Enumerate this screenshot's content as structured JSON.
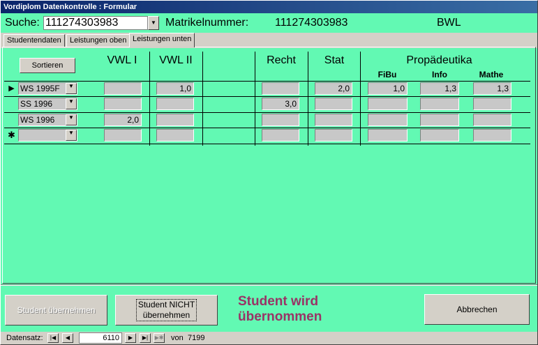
{
  "window": {
    "title": "Vordiplom Datenkontrolle : Formular"
  },
  "header": {
    "search_label": "Suche:",
    "search_value": "111274303983",
    "matrikel_label": "Matrikelnummer:",
    "matrikel_value": "111274303983",
    "program": "BWL"
  },
  "tabs": [
    {
      "label": "Studentendaten",
      "active": false
    },
    {
      "label": "Leistungen oben",
      "active": false
    },
    {
      "label": "Leistungen unten",
      "active": true
    }
  ],
  "grid": {
    "sort_button": "Sortieren",
    "columns": {
      "vwl1": "VWL I",
      "vwl2": "VWL II",
      "recht": "Recht",
      "stat": "Stat",
      "propaedeutika": "Propädeutika",
      "fibu": "FiBu",
      "info": "Info",
      "mathe": "Mathe"
    },
    "rows": [
      {
        "semester": "WS 1995F",
        "vwl1": "",
        "vwl2": "1,0",
        "recht": "",
        "stat": "2,0",
        "fibu": "1,0",
        "info": "1,3",
        "mathe": "1,3",
        "marker": "▶"
      },
      {
        "semester": "SS 1996",
        "vwl1": "",
        "vwl2": "",
        "recht": "3,0",
        "stat": "",
        "fibu": "",
        "info": "",
        "mathe": "",
        "marker": ""
      },
      {
        "semester": "WS 1996",
        "vwl1": "2,0",
        "vwl2": "",
        "recht": "",
        "stat": "",
        "fibu": "",
        "info": "",
        "mathe": "",
        "marker": ""
      },
      {
        "semester": "",
        "vwl1": "",
        "vwl2": "",
        "recht": "",
        "stat": "",
        "fibu": "",
        "info": "",
        "mathe": "",
        "marker": "✱"
      }
    ]
  },
  "actions": {
    "accept_label": "Student übernehmen",
    "reject_label_1": "Student NICHT",
    "reject_label_2": "übernehmen",
    "status_line_1": "Student wird",
    "status_line_2": "übernommen",
    "cancel_label": "Abbrechen"
  },
  "navigation": {
    "label": "Datensatz:",
    "current": "6110",
    "of_label": "von",
    "total": "7199"
  },
  "colors": {
    "form_bg": "#62f9b3",
    "status_text": "#993366"
  }
}
